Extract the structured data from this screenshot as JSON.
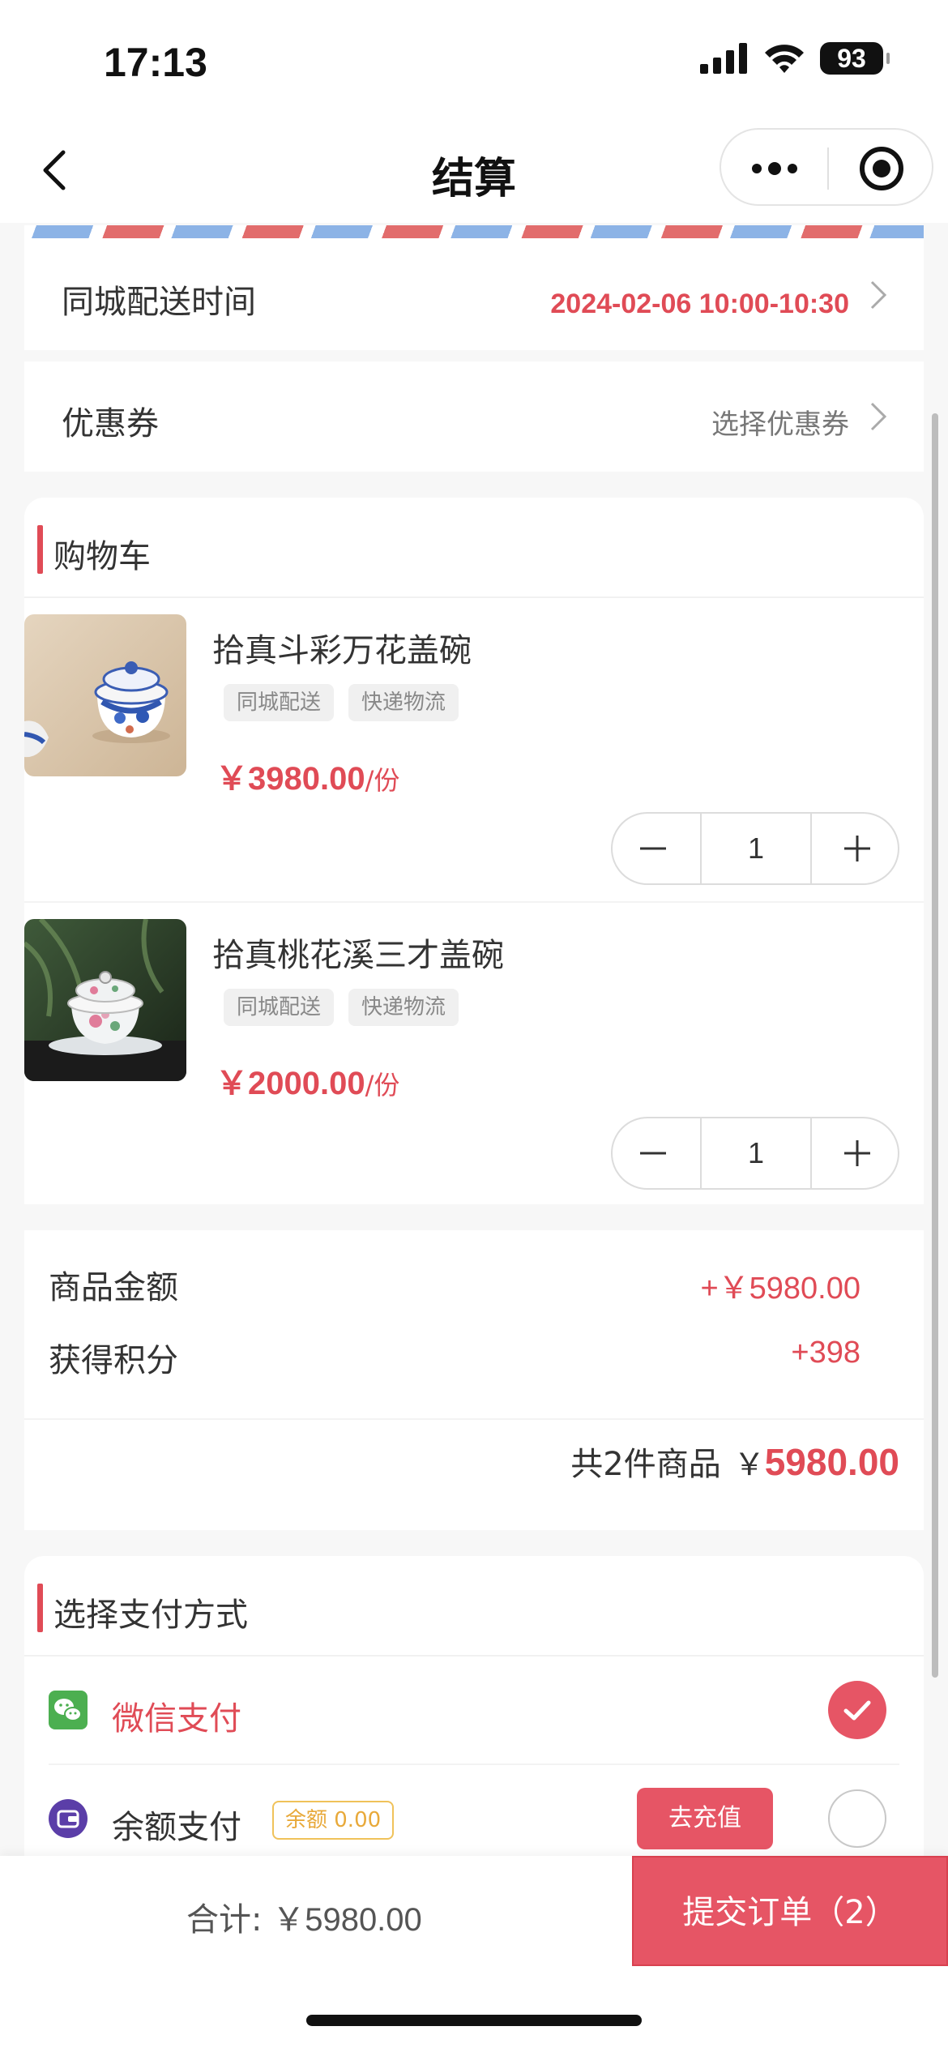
{
  "status_bar": {
    "time": "17:13",
    "battery": "93"
  },
  "nav": {
    "title": "结算"
  },
  "delivery": {
    "label": "同城配送时间",
    "value": "2024-02-06 10:00-10:30"
  },
  "coupon": {
    "label": "优惠券",
    "placeholder": "选择优惠券"
  },
  "cart": {
    "title": "购物车",
    "items": [
      {
        "name": "拾真斗彩万花盖碗",
        "tags": [
          "同城配送",
          "快递物流"
        ],
        "price": "￥3980.00",
        "unit": "/份",
        "quantity": "1"
      },
      {
        "name": "拾真桃花溪三才盖碗",
        "tags": [
          "同城配送",
          "快递物流"
        ],
        "price": "￥2000.00",
        "unit": "/份",
        "quantity": "1"
      }
    ]
  },
  "summary": {
    "goods_amount_label": "商品金额",
    "goods_amount_value": "+￥5980.00",
    "points_label": "获得积分",
    "points_value": "+398",
    "count_text": "共2件商品",
    "total_symbol": "￥",
    "total_amount": "5980.00"
  },
  "payment": {
    "title": "选择支付方式",
    "options": [
      {
        "label": "微信支付",
        "icon": "wechat-icon",
        "selected": true
      },
      {
        "label": "余额支付",
        "icon": "wallet-icon",
        "selected": false,
        "balance": "余额 0.00",
        "recharge_label": "去充值"
      }
    ]
  },
  "footer": {
    "total_label": "合计:",
    "total_value": "￥5980.00",
    "submit_label": "提交订单（2）"
  },
  "colors": {
    "accent": "#e04b56",
    "button": "#e65565",
    "wechat": "#4caf50",
    "wallet": "#5b3ea8",
    "badge": "#e8a93a"
  }
}
